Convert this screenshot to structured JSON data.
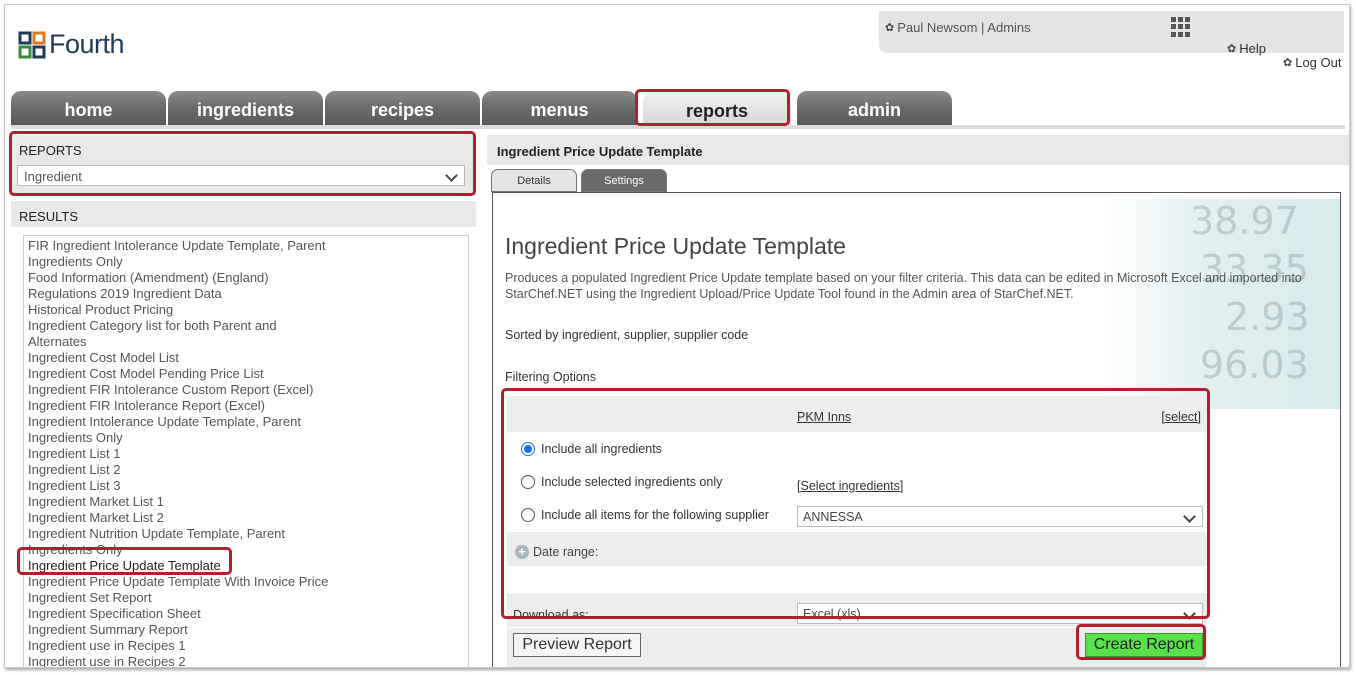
{
  "brand": {
    "name": "Fourth"
  },
  "user": {
    "label": "Paul Newsom | Admins",
    "help": "Help",
    "logout": "Log Out"
  },
  "tabs": [
    "home",
    "ingredients",
    "recipes",
    "menus",
    "reports",
    "admin"
  ],
  "active_tab": "reports",
  "left": {
    "reports_heading": "REPORTS",
    "reports_select": "Ingredient",
    "results_heading": "RESULTS",
    "results": [
      "FIR Ingredient Intolerance Update Template, Parent",
      "Ingredients Only",
      "Food Information (Amendment) (England)",
      "Regulations 2019 Ingredient Data",
      "Historical Product Pricing",
      "Ingredient Category list for both Parent and",
      "Alternates",
      "Ingredient Cost Model List",
      "Ingredient Cost Model Pending Price List",
      "Ingredient FIR Intolerance Custom Report (Excel)",
      "Ingredient FIR Intolerance Report (Excel)",
      "Ingredient Intolerance Update Template, Parent",
      "Ingredients Only",
      "Ingredient List 1",
      "Ingredient List 2",
      "Ingredient List 3",
      "Ingredient Market List 1",
      "Ingredient Market List 2",
      "Ingredient Nutrition Update Template, Parent",
      "Ingredients Only",
      "Ingredient Price Update Template",
      "Ingredient Price Update Template With Invoice Price",
      "Ingredient Set Report",
      "Ingredient Specification Sheet",
      "Ingredient Summary Report",
      "Ingredient use in Recipes 1",
      "Ingredient use in Recipes 2"
    ],
    "selected_result": "Ingredient Price Update Template"
  },
  "right": {
    "header": "Ingredient Price Update Template",
    "subtabs": {
      "details": "Details",
      "settings": "Settings"
    },
    "title": "Ingredient Price Update Template",
    "description": "Produces a populated Ingredient Price Update template based on your filter criteria. This data can be edited in Microsoft Excel and imported into StarChef.NET using the Ingredient Upload/Price Update Tool found in the Admin area of StarChef.NET.",
    "sorted": "Sorted by ingredient, supplier, supplier code",
    "filtering_title": "Filtering Options",
    "ticker": [
      "38.97",
      "33.35",
      "2.93",
      "96.03"
    ],
    "filter": {
      "site": "PKM Inns",
      "select_link": "select",
      "options": [
        {
          "label": "Include all ingredients",
          "checked": true
        },
        {
          "label": "Include selected ingredients only",
          "checked": false
        },
        {
          "label": "Include all items for the following supplier",
          "checked": false
        }
      ],
      "select_ingredients_link": "Select ingredients",
      "supplier": "ANNESSA",
      "date_range": "Date range:",
      "download_label": "Download as:",
      "download_format": "Excel (xls)"
    },
    "buttons": {
      "preview": "Preview Report",
      "create": "Create Report"
    }
  },
  "colors": {
    "highlight": "#b21f2d",
    "create_button": "#58e14a",
    "tab_dark": "#6a6a6a"
  }
}
